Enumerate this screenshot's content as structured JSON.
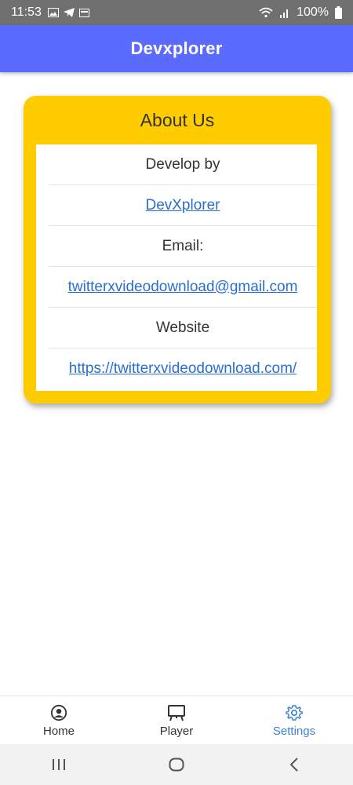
{
  "status_bar": {
    "time": "11:53",
    "battery": "100%"
  },
  "app_bar": {
    "title": "Devxplorer"
  },
  "about": {
    "title": "About Us",
    "rows": [
      {
        "text": "Develop by",
        "link": false
      },
      {
        "text": "DevXplorer",
        "link": true
      },
      {
        "text": "Email:",
        "link": false
      },
      {
        "text": "twitterxvideodownload@gmail.com",
        "link": true
      },
      {
        "text": "Website",
        "link": false
      },
      {
        "text": "https://twitterxvideodownload.com/",
        "link": true
      }
    ]
  },
  "bottom_nav": {
    "items": [
      {
        "label": "Home",
        "icon": "account-circle-icon"
      },
      {
        "label": "Player",
        "icon": "easel-icon"
      },
      {
        "label": "Settings",
        "icon": "gear-icon",
        "active": true
      }
    ]
  },
  "colors": {
    "app_bar": "#5c6bff",
    "card": "#ffcc00",
    "link": "#2a6fcf",
    "active_nav": "#3b82d6"
  }
}
